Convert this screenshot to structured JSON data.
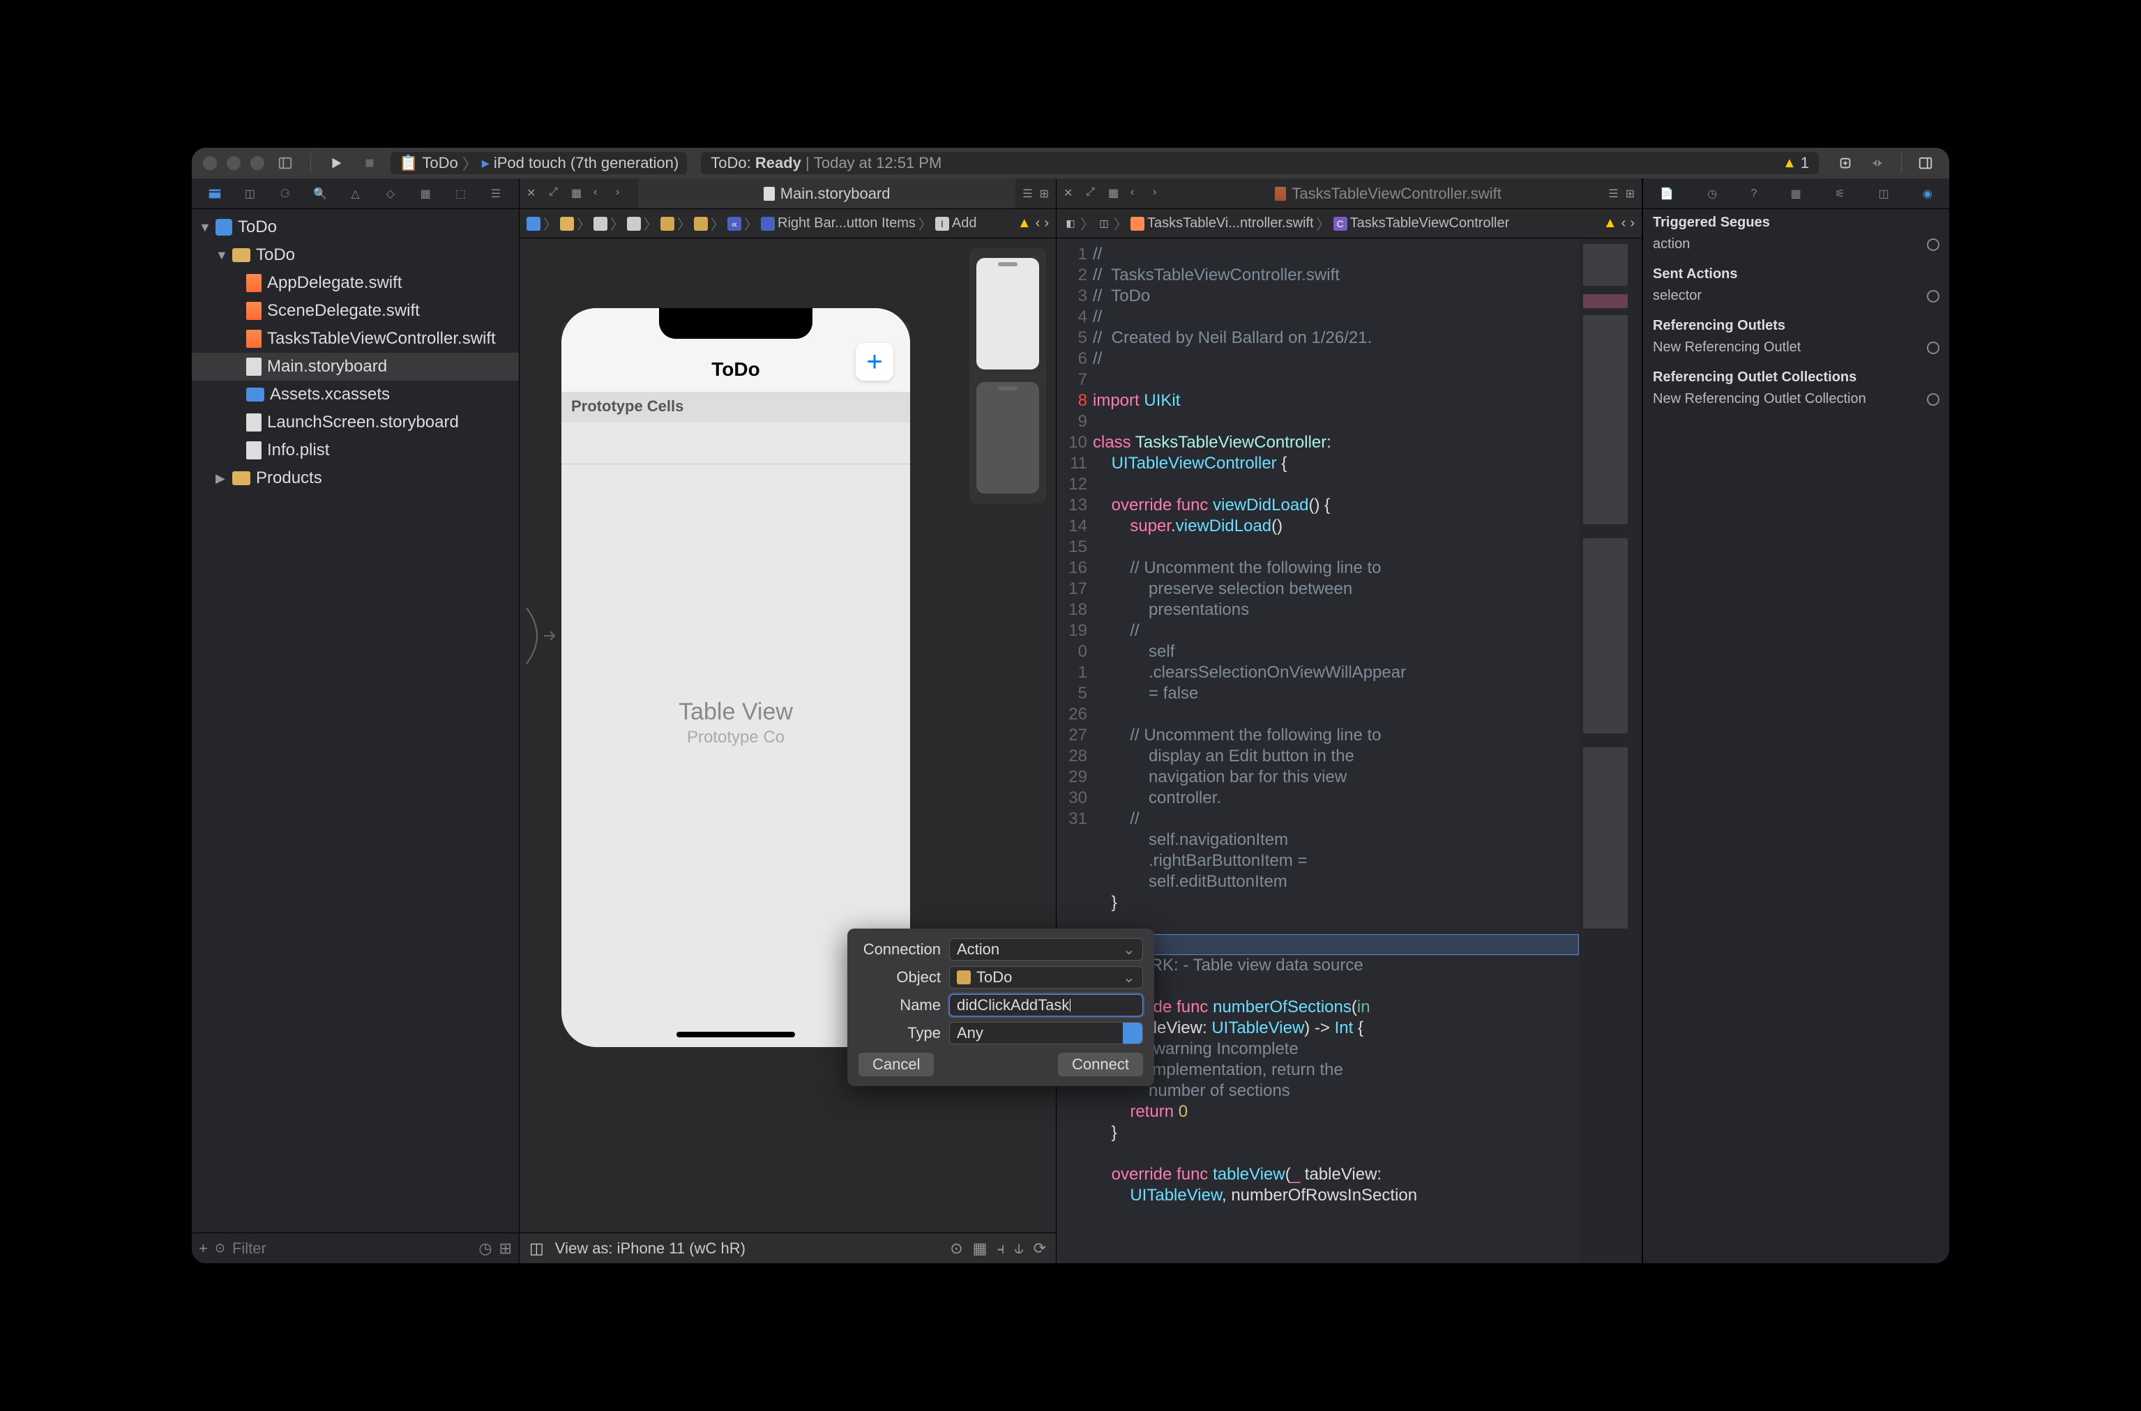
{
  "titlebar": {
    "scheme_app": "ToDo",
    "scheme_device": "iPod touch (7th generation)",
    "status_left": "ToDo:",
    "status_ready": "Ready",
    "status_time": "Today at 12:51 PM",
    "warning_count": "1"
  },
  "navigator": {
    "project": "ToDo",
    "group": "ToDo",
    "files": [
      "AppDelegate.swift",
      "SceneDelegate.swift",
      "TasksTableViewController.swift",
      "Main.storyboard",
      "Assets.xcassets",
      "LaunchScreen.storyboard",
      "Info.plist"
    ],
    "products": "Products",
    "filter_placeholder": "Filter"
  },
  "left_tab": {
    "title": "Main.storyboard"
  },
  "right_tab": {
    "title": "TasksTableViewController.swift"
  },
  "jump_left": {
    "segments": [
      "Right Bar...utton Items",
      "Add"
    ],
    "icon_label": "I"
  },
  "jump_right": {
    "path1": "TasksTableVi...ntroller.swift",
    "path2": "TasksTableViewController",
    "icon_label": "C"
  },
  "canvas": {
    "nav_title": "ToDo",
    "proto_label": "Prototype Cells",
    "tv_label": "Table View",
    "tv_sub": "Prototype Co"
  },
  "bottom_bar": {
    "view_as": "View as: iPhone 11 (",
    "wc": "w",
    "wc2": "C ",
    "hr": "h",
    "hr2": "R)"
  },
  "popover": {
    "connection_label": "Connection",
    "connection_value": "Action",
    "object_label": "Object",
    "object_value": "ToDo",
    "name_label": "Name",
    "name_value": "didClickAddTask",
    "type_label": "Type",
    "type_value": "Any",
    "cancel": "Cancel",
    "connect": "Connect"
  },
  "code": {
    "lines": [
      {
        "n": 1,
        "t": "//",
        "cls": "cm"
      },
      {
        "n": 2,
        "t": "//  TasksTableViewController.swift",
        "cls": "cm"
      },
      {
        "n": 3,
        "t": "//  ToDo",
        "cls": "cm"
      },
      {
        "n": 4,
        "t": "//",
        "cls": "cm"
      },
      {
        "n": 5,
        "t": "//  Created by Neil Ballard on 1/26/21.",
        "cls": "cm"
      },
      {
        "n": 6,
        "t": "//",
        "cls": "cm"
      },
      {
        "n": 7,
        "t": ""
      },
      {
        "n": 8,
        "html": "<span class='kw'>import</span> <span class='type'>UIKit</span>"
      },
      {
        "n": 9,
        "t": ""
      },
      {
        "n": 10,
        "html": "<span class='kw'>class</span> <span class='utype'>TasksTableViewController</span>:"
      },
      {
        "n": "",
        "html": "    <span class='type'>UITableViewController</span> {"
      },
      {
        "n": 11,
        "t": ""
      },
      {
        "n": 12,
        "html": "    <span class='kw'>override</span> <span class='kw'>func</span> <span class='type'>viewDidLoad</span>() {"
      },
      {
        "n": 13,
        "html": "        <span class='kw'>super</span>.<span class='type'>viewDidLoad</span>()"
      },
      {
        "n": 14,
        "t": ""
      },
      {
        "n": 15,
        "html": "        <span class='cm'>// Uncomment the following line to</span>"
      },
      {
        "n": "",
        "html": "            <span class='cm'>preserve selection between</span>"
      },
      {
        "n": "",
        "html": "            <span class='cm'>presentations</span>"
      },
      {
        "n": 16,
        "html": "        <span class='cm'>//</span>"
      },
      {
        "n": "",
        "html": "            <span class='cm'>self</span>"
      },
      {
        "n": "",
        "html": "            <span class='cm'>.clearsSelectionOnViewWillAppear</span>"
      },
      {
        "n": "",
        "html": "            <span class='cm'>= false</span>"
      },
      {
        "n": 17,
        "t": ""
      },
      {
        "n": 18,
        "html": "        <span class='cm'>// Uncomment the following line to</span>"
      },
      {
        "n": "",
        "html": "            <span class='cm'>display an Edit button in the</span>"
      },
      {
        "n": "",
        "html": "            <span class='cm'>navigation bar for this view</span>"
      },
      {
        "n": "",
        "html": "            <span class='cm'>controller.</span>"
      },
      {
        "n": 19,
        "html": "        <span class='cm'>//</span>"
      },
      {
        "n": "",
        "html": "            <span class='cm'>self.navigationItem</span>"
      },
      {
        "n": "",
        "html": "            <span class='cm'>.rightBarButtonItem =</span>"
      },
      {
        "n": "",
        "html": "            <span class='cm'>self.editButtonItem</span>"
      },
      {
        "n": "0",
        "t": "    }"
      },
      {
        "n": "1",
        "t": ""
      },
      {
        "n": "",
        "insert": true
      },
      {
        "n": "",
        "html": "    <span class='cm'>// MARK: - Table view data source</span>"
      },
      {
        "n": "5",
        "t": ""
      },
      {
        "n": 26,
        "html": "    <span class='kw'>override</span> <span class='kw'>func</span> <span class='type'>numberOfSections</span>(<span class='fn'>in</span>"
      },
      {
        "n": "",
        "html": "        tableView: <span class='type'>UITableView</span>) -> <span class='type'>Int</span> {"
      },
      {
        "n": 27,
        "html": "        <span class='cm'>// #warning Incomplete</span>"
      },
      {
        "n": "",
        "html": "            <span class='cm'>implementation, return the</span>"
      },
      {
        "n": "",
        "html": "            <span class='cm'>number of sections</span>"
      },
      {
        "n": 28,
        "html": "        <span class='kw'>return</span> <span class='num'>0</span>"
      },
      {
        "n": 29,
        "t": "    }"
      },
      {
        "n": 30,
        "t": ""
      },
      {
        "n": 31,
        "html": "    <span class='kw'>override</span> <span class='kw'>func</span> <span class='type'>tableView</span>(<span class='kw'>_</span> tableView:"
      },
      {
        "n": "",
        "html": "        <span class='type'>UITableView</span>, numberOfRowsInSection"
      }
    ]
  },
  "inspector": {
    "sections": [
      {
        "title": "Triggered Segues",
        "rows": [
          "action"
        ]
      },
      {
        "title": "Sent Actions",
        "rows": [
          "selector"
        ]
      },
      {
        "title": "Referencing Outlets",
        "rows": [
          "New Referencing Outlet"
        ]
      },
      {
        "title": "Referencing Outlet Collections",
        "rows": [
          "New Referencing Outlet Collection"
        ]
      }
    ]
  }
}
